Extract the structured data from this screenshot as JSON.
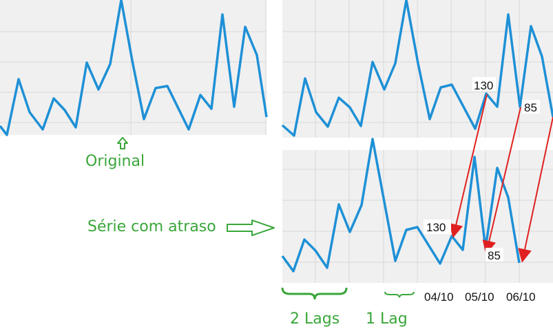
{
  "labels": {
    "original": "Original",
    "lagged_series": "Série com atraso",
    "two_lags": "2 Lags",
    "one_lag": "1 Lag"
  },
  "dates": [
    "04/10",
    "05/10",
    "06/10"
  ],
  "value_labels": {
    "top_130": "130",
    "top_85": "85",
    "bottom_130": "130",
    "bottom_85": "85"
  },
  "colors": {
    "series": "#1e90d6",
    "annotation": "#3aa63a",
    "arrow": "#e02020",
    "grid": "#d8d8d8",
    "panel": "#f0f0f0"
  }
}
